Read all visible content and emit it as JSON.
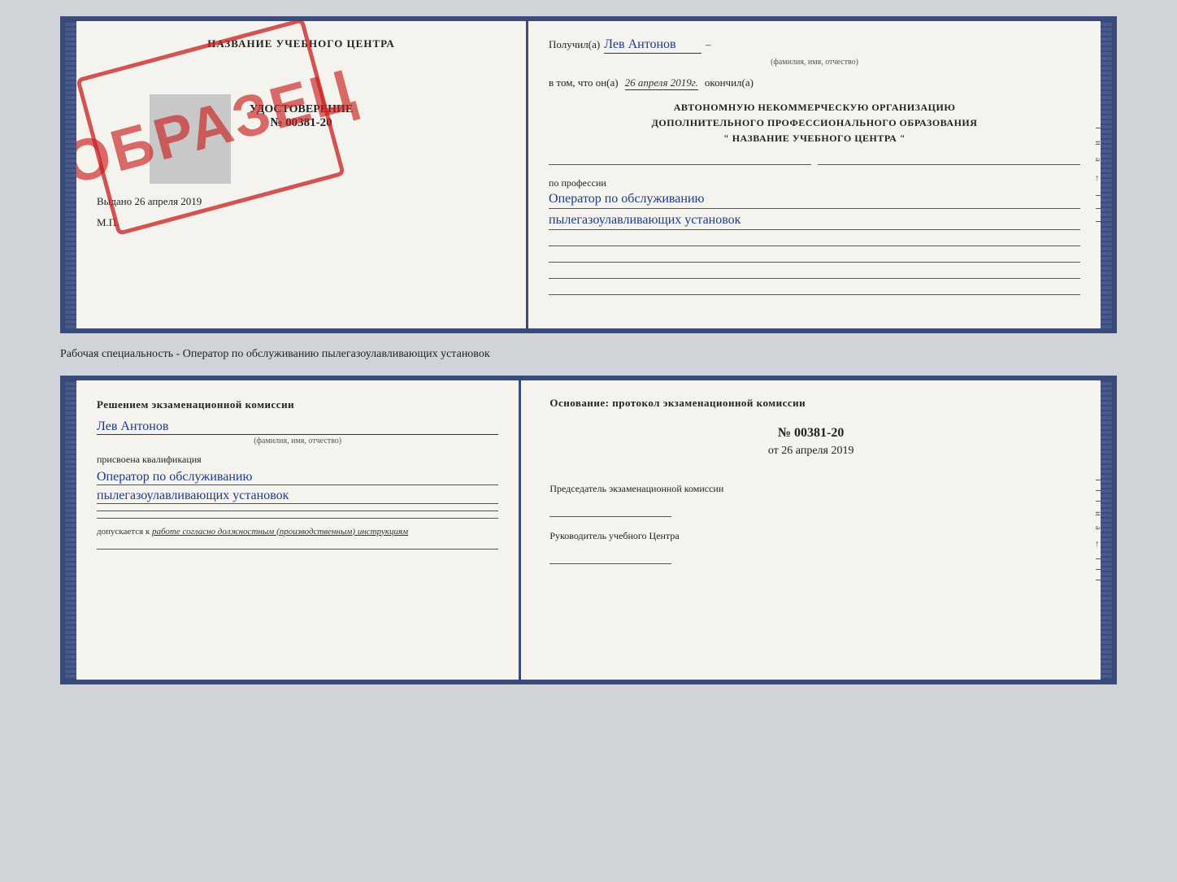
{
  "top_cert": {
    "left": {
      "title": "НАЗВАНИЕ УЧЕБНОГО ЦЕНТРА",
      "doc_type": "УДОСТОВЕРЕНИЕ",
      "number": "№ 00381-20",
      "vydano_label": "Выдано",
      "vydano_date": "26 апреля 2019",
      "mp_label": "М.П."
    },
    "right": {
      "poluchil_label": "Получил(а)",
      "poluchil_name": "Лев Антонов",
      "fio_sub": "(фамилия, имя, отчество)",
      "vtom_label": "в том, что он(а)",
      "date_value": "26 апреля 2019г.",
      "okonchil_label": "окончил(а)",
      "org_line1": "АВТОНОМНУЮ НЕКОММЕРЧЕСКУЮ ОРГАНИЗАЦИЮ",
      "org_line2": "ДОПОЛНИТЕЛЬНОГО ПРОФЕССИОНАЛЬНОГО ОБРАЗОВАНИЯ",
      "org_line3": "\"  НАЗВАНИЕ УЧЕБНОГО ЦЕНТРА  \"",
      "profession_label": "по профессии",
      "profession_line1": "Оператор по обслуживанию",
      "profession_line2": "пылегазоулавливающих установок"
    },
    "sidebar_chars": [
      "и",
      "а",
      "←",
      "",
      "",
      ""
    ]
  },
  "between_label": "Рабочая специальность - Оператор по обслуживанию пылегазоулавливающих установок",
  "bottom_cert": {
    "left": {
      "resheniem_title": "Решением экзаменационной комиссии",
      "name_value": "Лев Антонов",
      "fio_sub": "(фамилия, имя, отчество)",
      "prisvoena_label": "присвоена квалификация",
      "kval_line1": "Оператор по обслуживанию",
      "kval_line2": "пылегазоулавливающих установок",
      "dopusk_label": "допускается к",
      "dopusk_value": "работе согласно должностным (производственным) инструкциям"
    },
    "right": {
      "osnov_label": "Основание: протокол экзаменационной комиссии",
      "number_value": "№  00381-20",
      "ot_prefix": "от",
      "date_value": "26 апреля 2019",
      "predsedatel_title": "Председатель экзаменационной комиссии",
      "rukovoditel_title": "Руководитель учебного Центра"
    },
    "sidebar_chars": [
      "и",
      "а",
      "←",
      "",
      "",
      ""
    ]
  },
  "stamp": {
    "text": "ОБРАЗЕЦ"
  }
}
